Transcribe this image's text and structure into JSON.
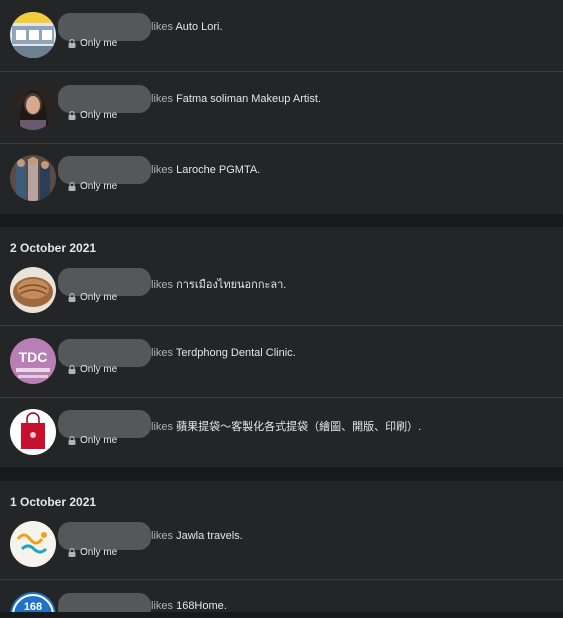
{
  "rows_group1": [
    {
      "verb": "likes",
      "target": "Auto Lori.",
      "privacy": "Only me",
      "avatar_icon": "auto-lori-avatar"
    },
    {
      "verb": "likes",
      "target": "Fatma soliman Makeup Artist.",
      "privacy": "Only me",
      "avatar_icon": "fatma-soliman-avatar"
    },
    {
      "verb": "likes",
      "target": "Laroche PGMTA.",
      "privacy": "Only me",
      "avatar_icon": "laroche-avatar"
    }
  ],
  "section2": {
    "date": "2 October 2021",
    "rows": [
      {
        "verb": "likes",
        "target": "การเมืองไทยนอกกะลา.",
        "privacy": "Only me",
        "avatar_icon": "politics-avatar"
      },
      {
        "verb": "likes",
        "target": "Terdphong Dental Clinic.",
        "privacy": "Only me",
        "avatar_icon": "tdc-avatar",
        "avatar_text": "TDC"
      },
      {
        "verb": "likes",
        "target": "蘋果提袋～客製化各式提袋（繪圖、開版、印刷）.",
        "privacy": "Only me",
        "avatar_icon": "bag-avatar"
      }
    ]
  },
  "section3": {
    "date": "1 October 2021",
    "rows": [
      {
        "verb": "likes",
        "target": "Jawla travels.",
        "privacy": "Only me",
        "avatar_icon": "jawla-avatar"
      },
      {
        "verb": "likes",
        "target": "168Home.",
        "privacy": "",
        "avatar_icon": "168home-avatar",
        "avatar_text": "168"
      }
    ]
  },
  "colors": {
    "background": "#18191a",
    "card": "#242526",
    "text": "#e4e6eb",
    "secondary_text": "#b0b3b8",
    "divider": "#3a3b3c"
  },
  "icons": {
    "privacy": "lock-icon"
  }
}
